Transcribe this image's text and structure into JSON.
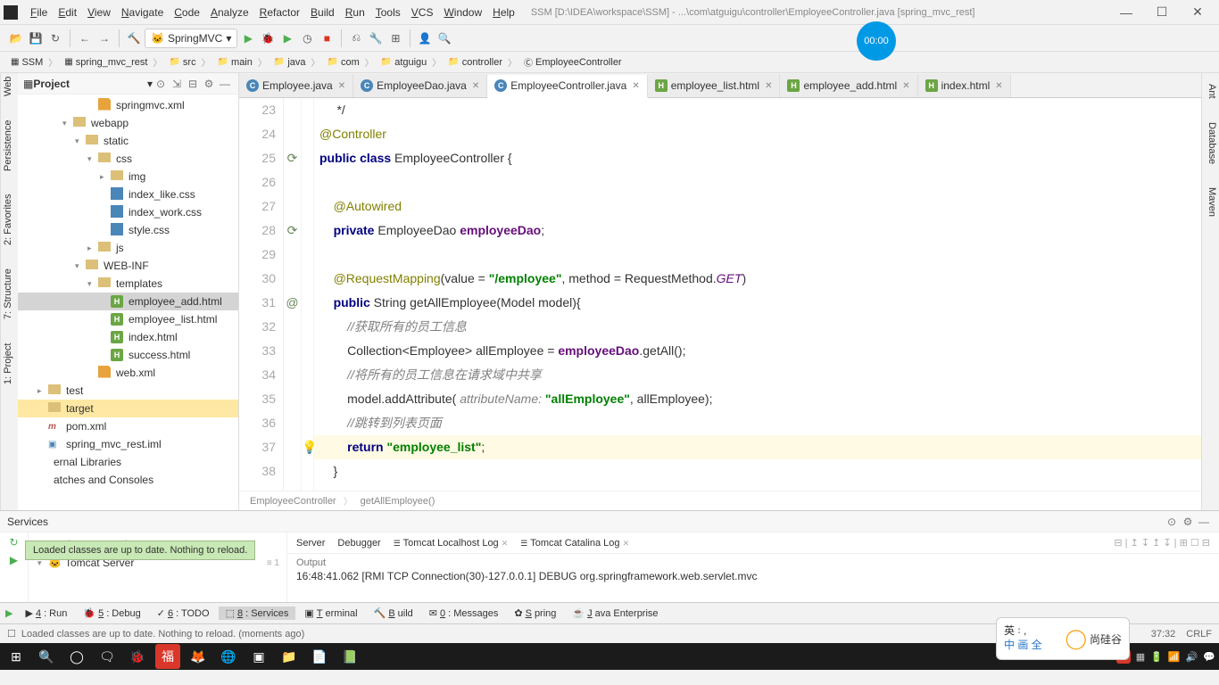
{
  "title_bar": {
    "menus": [
      "File",
      "Edit",
      "View",
      "Navigate",
      "Code",
      "Analyze",
      "Refactor",
      "Build",
      "Run",
      "Tools",
      "VCS",
      "Window",
      "Help"
    ],
    "title": "SSM [D:\\IDEA\\workspace\\SSM] - ...\\com\\atguigu\\controller\\EmployeeController.java [spring_mvc_rest]"
  },
  "timer": "00:00",
  "toolbar": {
    "config": "SpringMVC"
  },
  "breadcrumbs": [
    "SSM",
    "spring_mvc_rest",
    "src",
    "main",
    "java",
    "com",
    "atguigu",
    "controller",
    "EmployeeController"
  ],
  "project": {
    "title": "Project",
    "tree": [
      {
        "indent": 5,
        "arrow": "",
        "icon": "xml",
        "label": "springmvc.xml"
      },
      {
        "indent": 3,
        "arrow": "v",
        "icon": "f",
        "label": "webapp"
      },
      {
        "indent": 4,
        "arrow": "v",
        "icon": "f",
        "label": "static"
      },
      {
        "indent": 5,
        "arrow": "v",
        "icon": "f",
        "label": "css"
      },
      {
        "indent": 6,
        "arrow": ">",
        "icon": "f",
        "label": "img"
      },
      {
        "indent": 6,
        "arrow": "",
        "icon": "css",
        "label": "index_like.css"
      },
      {
        "indent": 6,
        "arrow": "",
        "icon": "css",
        "label": "index_work.css"
      },
      {
        "indent": 6,
        "arrow": "",
        "icon": "css",
        "label": "style.css"
      },
      {
        "indent": 5,
        "arrow": ">",
        "icon": "f",
        "label": "js"
      },
      {
        "indent": 4,
        "arrow": "v",
        "icon": "f",
        "label": "WEB-INF"
      },
      {
        "indent": 5,
        "arrow": "v",
        "icon": "f",
        "label": "templates"
      },
      {
        "indent": 6,
        "arrow": "",
        "icon": "h",
        "label": "employee_add.html",
        "selected": true
      },
      {
        "indent": 6,
        "arrow": "",
        "icon": "h",
        "label": "employee_list.html"
      },
      {
        "indent": 6,
        "arrow": "",
        "icon": "h",
        "label": "index.html"
      },
      {
        "indent": 6,
        "arrow": "",
        "icon": "h",
        "label": "success.html"
      },
      {
        "indent": 5,
        "arrow": "",
        "icon": "xml",
        "label": "web.xml"
      },
      {
        "indent": 1,
        "arrow": ">",
        "icon": "f",
        "label": "test"
      },
      {
        "indent": 1,
        "arrow": "",
        "icon": "f",
        "label": "target",
        "highlight": true
      },
      {
        "indent": 1,
        "arrow": "",
        "icon": "m",
        "label": "pom.xml"
      },
      {
        "indent": 1,
        "arrow": "",
        "icon": "i",
        "label": "spring_mvc_rest.iml"
      },
      {
        "indent": 0,
        "arrow": "",
        "icon": "",
        "label": "ernal Libraries"
      },
      {
        "indent": 0,
        "arrow": "",
        "icon": "",
        "label": "atches and Consoles"
      }
    ]
  },
  "left_tabs": [
    "1: Project",
    "7: Structure",
    "2: Favorites",
    "Persistence",
    "Web"
  ],
  "right_tabs": [
    "Ant",
    "Database",
    "Maven"
  ],
  "editor": {
    "tabs": [
      {
        "icon": "c",
        "label": "Employee.java",
        "active": false
      },
      {
        "icon": "c",
        "label": "EmployeeDao.java",
        "active": false
      },
      {
        "icon": "c",
        "label": "EmployeeController.java",
        "active": true
      },
      {
        "icon": "h",
        "label": "employee_list.html",
        "active": false
      },
      {
        "icon": "h",
        "label": "employee_add.html",
        "active": false
      },
      {
        "icon": "h",
        "label": "index.html",
        "active": false
      }
    ],
    "lines": [
      {
        "n": 23,
        "html": "     */",
        "cls": "comment"
      },
      {
        "n": 24,
        "html": "<span class='ann'>@Controller</span>"
      },
      {
        "n": 25,
        "html": "<span class='kw'>public class</span> EmployeeController {",
        "g": "⟳"
      },
      {
        "n": 26,
        "html": ""
      },
      {
        "n": 27,
        "html": "    <span class='ann'>@Autowired</span>"
      },
      {
        "n": 28,
        "html": "    <span class='kw'>private</span> EmployeeDao <span class='field'>employeeDao</span>;",
        "g": "⟳"
      },
      {
        "n": 29,
        "html": ""
      },
      {
        "n": 30,
        "html": "    <span class='ann'>@RequestMapping</span>(value = <span class='str'>\"/employee\"</span>, method = RequestMethod.<span class='static'>GET</span>)"
      },
      {
        "n": 31,
        "html": "    <span class='kw'>public</span> String getAllEmployee(Model model){",
        "g": "@"
      },
      {
        "n": 32,
        "html": "        <span class='comment'>//获取所有的员工信息</span>"
      },
      {
        "n": 33,
        "html": "        Collection&lt;Employee&gt; allEmployee = <span class='field'>employeeDao</span>.getAll();"
      },
      {
        "n": 34,
        "html": "        <span class='comment'>//将所有的员工信息在请求域中共享</span>"
      },
      {
        "n": 35,
        "html": "        model.addAttribute( <span class='param'>attributeName:</span> <span class='str'>\"allEmployee\"</span>, allEmployee);"
      },
      {
        "n": 36,
        "html": "        <span class='comment'>//跳转到列表页面</span>"
      },
      {
        "n": 37,
        "html": "        <span class='kw'>return</span> <span class='str'>\"employee_list\"</span>;",
        "hl": true,
        "bulb": true
      },
      {
        "n": 38,
        "html": "    }"
      }
    ],
    "crumbs": [
      "EmployeeController",
      "getAllEmployee()"
    ]
  },
  "services": {
    "title": "Services",
    "tree_item": "Tomcat Server",
    "toast": "Loaded classes are up to date. Nothing to reload.",
    "tabs": [
      "Server",
      "Debugger",
      "Tomcat Localhost Log",
      "Tomcat Catalina Log"
    ],
    "output_label": "Output",
    "output_line": "16:48:41.062 [RMI TCP Connection(30)-127.0.0.1] DEBUG org.springframework.web.servlet.mvc"
  },
  "bottom_tabs": [
    {
      "label": "4: Run",
      "icon": "▶"
    },
    {
      "label": "5: Debug",
      "icon": "🐞"
    },
    {
      "label": "6: TODO",
      "icon": "✓"
    },
    {
      "label": "8: Services",
      "icon": "⬚",
      "active": true
    },
    {
      "label": "Terminal",
      "icon": "▣"
    },
    {
      "label": "Build",
      "icon": "🔨"
    },
    {
      "label": "0: Messages",
      "icon": "✉"
    },
    {
      "label": "Spring",
      "icon": "✿"
    },
    {
      "label": "Java Enterprise",
      "icon": "☕"
    }
  ],
  "statusbar": {
    "msg": "Loaded classes are up to date. Nothing to reload. (moments ago)",
    "pos": "37:32",
    "eol": "CRLF"
  },
  "ime": {
    "lines": [
      "英 ꞉ ,",
      "中 画 全"
    ],
    "brand": "尚硅谷"
  }
}
